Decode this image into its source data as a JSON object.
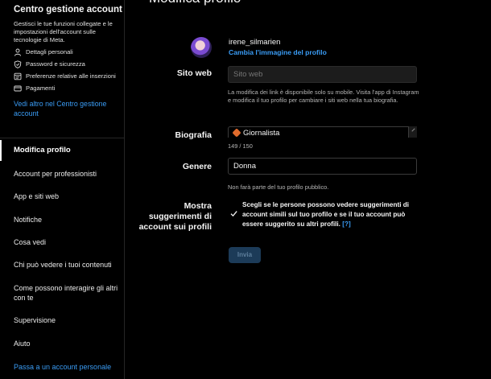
{
  "sidebar": {
    "account_center": {
      "title": "Centro gestione account",
      "description": "Gestisci le tue funzioni collegate e le impostazioni dell'account sulle tecnologie di Meta.",
      "items": [
        {
          "icon": "personal-details-icon",
          "label": "Dettagli personali"
        },
        {
          "icon": "shield-icon",
          "label": "Password e sicurezza"
        },
        {
          "icon": "ad-preferences-icon",
          "label": "Preferenze relative alle inserzioni"
        },
        {
          "icon": "payments-icon",
          "label": "Pagamenti"
        }
      ],
      "more_link": "Vedi altro nel Centro gestione account"
    },
    "nav": [
      {
        "label": "Modifica profilo",
        "active": true
      },
      {
        "label": "Account per professionisti"
      },
      {
        "label": "App e siti web"
      },
      {
        "label": "Notifiche"
      },
      {
        "label": "Cosa vedi"
      },
      {
        "label": "Chi può vedere i tuoi contenuti"
      },
      {
        "label": "Come possono interagire gli altri con te"
      },
      {
        "label": "Supervisione"
      },
      {
        "label": "Aiuto"
      },
      {
        "label": "Passa a un account personale",
        "link": true
      }
    ]
  },
  "main": {
    "title": "Modifica profilo",
    "username": "irene_silmarien",
    "change_photo": "Cambia l'immagine del profilo",
    "website": {
      "label": "Sito web",
      "placeholder": "Sito web",
      "help": "La modifica dei link è disponibile solo su mobile. Visita l'app di Instagram e modifica il tuo profilo per cambiare i siti web nella tua biografia."
    },
    "bio": {
      "label": "Biografia",
      "value": "Giornalista",
      "counter": "149 / 150"
    },
    "gender": {
      "label": "Genere",
      "value": "Donna",
      "help": "Non farà parte del tuo profilo pubblico."
    },
    "suggestions": {
      "label": "Mostra suggerimenti di account sui profili",
      "text": "Scegli se le persone possono vedere suggerimenti di account simili sul tuo profilo e se il tuo account può essere suggerito su altri profili.",
      "help_link": "[?]",
      "checked": true
    },
    "submit_label": "Invia"
  },
  "colors": {
    "background": "#000000",
    "accent": "#3a9cf5",
    "submit_disabled": "#1c3b58"
  }
}
